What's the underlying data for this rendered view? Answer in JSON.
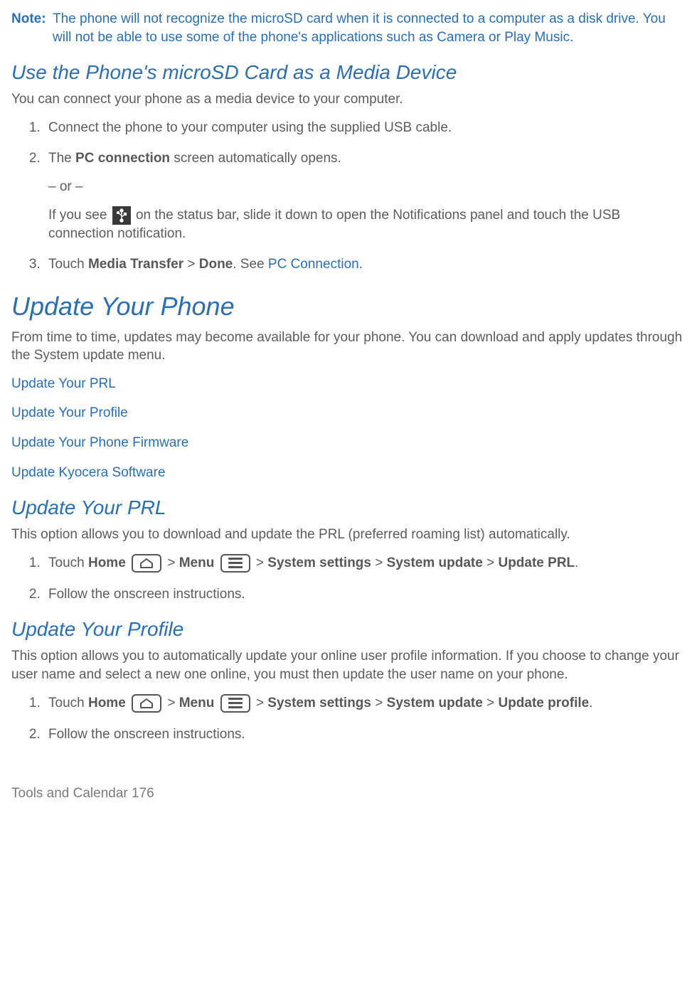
{
  "note": {
    "label": "Note:",
    "body": "The phone will not recognize the microSD card when it is connected to a computer as a disk drive. You will not be able to use some of the phone's applications such as Camera or Play Music."
  },
  "sec1": {
    "heading": "Use the Phone's microSD Card as a Media Device",
    "intro": "You can connect your phone as a media device to your computer.",
    "li1": "Connect the phone to your computer using the supplied USB cable.",
    "li2_pre": "The ",
    "li2_bold": "PC connection",
    "li2_post": " screen automatically opens.",
    "li2_or": "– or –",
    "li2b_pre": "If you see ",
    "li2b_post": " on the status bar, slide it down to open the Notifications panel and touch the USB connection notification.",
    "li3_pre": "Touch ",
    "li3_b1": "Media Transfer",
    "li3_mid": " > ",
    "li3_b2": "Done",
    "li3_post1": ". See ",
    "li3_link": "PC Connection",
    "li3_post2": "."
  },
  "sec2": {
    "heading": "Update Your Phone",
    "intro": "From time to time, updates may become available for your phone. You can download and apply updates through the System update menu.",
    "toc": {
      "a": "Update Your PRL",
      "b": "Update Your Profile",
      "c": "Update Your Phone Firmware",
      "d": "Update Kyocera Software"
    }
  },
  "sec3": {
    "heading": "Update Your PRL",
    "intro": "This option allows you to download and update the PRL (preferred roaming list) automatically.",
    "li1": {
      "touch": "Touch ",
      "home": "Home",
      "gt1": " > ",
      "menu": "Menu",
      "gt2": " > ",
      "p1": "System settings",
      "gt3": " > ",
      "p2": "System update",
      "gt4": " > ",
      "p3": "Update PRL",
      "end": "."
    },
    "li2": "Follow the onscreen instructions."
  },
  "sec4": {
    "heading": "Update Your Profile",
    "intro": "This option allows you to automatically update your online user profile information. If you choose to change your user name and select a new one online, you must then update the user name on your phone.",
    "li1": {
      "touch": "Touch ",
      "home": "Home",
      "gt1": " > ",
      "menu": "Menu",
      "gt2": " > ",
      "p1": "System settings",
      "gt3": " > ",
      "p2": "System update",
      "gt4": " > ",
      "p3": "Update profile",
      "end": "."
    },
    "li2": "Follow the onscreen instructions."
  },
  "footer": {
    "section": "Tools and Calendar",
    "page": "176"
  }
}
